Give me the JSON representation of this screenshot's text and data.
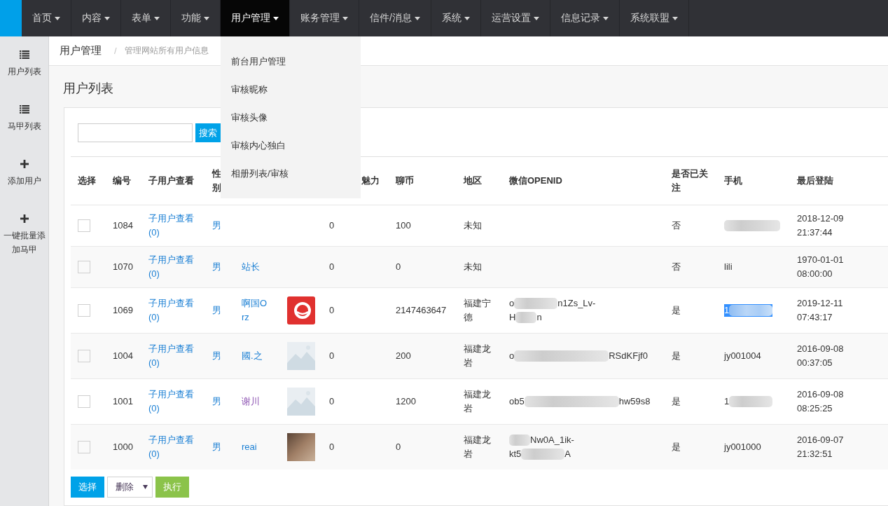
{
  "nav": {
    "items": [
      {
        "label": "首页",
        "selected": false
      },
      {
        "label": "内容",
        "selected": false
      },
      {
        "label": "表单",
        "selected": false
      },
      {
        "label": "功能",
        "selected": false
      },
      {
        "label": "用户管理",
        "selected": true,
        "menu": [
          "前台用户管理",
          "审核昵称",
          "审核头像",
          "审核内心独白",
          "相册列表/审核"
        ]
      },
      {
        "label": "账务管理",
        "selected": false
      },
      {
        "label": "信件/消息",
        "selected": false
      },
      {
        "label": "系统",
        "selected": false
      },
      {
        "label": "运营设置",
        "selected": false
      },
      {
        "label": "信息记录",
        "selected": false
      },
      {
        "label": "系统联盟",
        "selected": false
      }
    ]
  },
  "sidebar": {
    "items": [
      {
        "label": "用户列表",
        "kind": "list"
      },
      {
        "label": "马甲列表",
        "kind": "list"
      },
      {
        "label": "添加用户",
        "kind": "add"
      },
      {
        "label": "一键批量添加马甲",
        "kind": "add"
      }
    ]
  },
  "breadcrumb": {
    "title": "用户管理",
    "separator": "/",
    "description": "管理网站所有用户信息"
  },
  "page_title": "用户列表",
  "search": {
    "button": "搜索"
  },
  "table": {
    "columns": [
      {
        "label": "选择"
      },
      {
        "label": "编号"
      },
      {
        "label": "子用户查看"
      },
      {
        "label": "性别"
      },
      {},
      {},
      {},
      {
        "label": "魅力"
      },
      {
        "label": "聊币"
      },
      {
        "label": "地区"
      },
      {
        "label": "微信OPENID"
      },
      {
        "label": "是否已关注"
      },
      {
        "label": "手机"
      },
      {
        "label": "最后登陆"
      }
    ],
    "rows": [
      {
        "checked": false,
        "id": "1084",
        "sub_users": "子用户查看 (0)",
        "gender": "男",
        "column_7": "0",
        "coins": "100",
        "region": "未知",
        "followed": "否",
        "phone": {
          "highlighted": false,
          "parts": [
            {
              "kind": "wideblur"
            }
          ]
        },
        "last_login": "2018-12-09 21:37:44"
      },
      {
        "checked": false,
        "id": "1070",
        "sub_users": "子用户查看 (0)",
        "gender": "男",
        "nickname": {
          "text": "站长",
          "visited": false
        },
        "column_7": "0",
        "coins": "0",
        "region": "未知",
        "followed": "否",
        "phone": {
          "highlighted": false,
          "parts": [
            {
              "kind": "text",
              "text": "lili"
            }
          ]
        },
        "last_login": "1970-01-01 08:00:00"
      },
      {
        "checked": false,
        "id": "1069",
        "sub_users": "子用户查看 (0)",
        "gender": "男",
        "nickname": {
          "text": "啊国Orz",
          "visited": false
        },
        "avatar": {
          "kind": "logo"
        },
        "column_7": "0",
        "coins": "2147463647",
        "region": "福建宁德",
        "openid": {
          "lines": [
            [
              {
                "kind": "text",
                "text": "o"
              },
              {
                "kind": "blur"
              },
              {
                "kind": "text",
                "text": "n1Zs_Lv-"
              }
            ],
            [
              {
                "kind": "text",
                "text": "H"
              },
              {
                "kind": "shortblur"
              },
              {
                "kind": "text",
                "text": "n"
              }
            ]
          ]
        },
        "followed": "是",
        "phone": {
          "highlighted": true,
          "parts": [
            {
              "kind": "text",
              "text": "1"
            },
            {
              "kind": "blur"
            }
          ]
        },
        "last_login": "2019-12-11 07:43:17"
      },
      {
        "checked": false,
        "id": "1004",
        "sub_users": "子用户查看 (0)",
        "gender": "男",
        "nickname": {
          "text": "國.之",
          "visited": false
        },
        "avatar": {
          "kind": "placeholder"
        },
        "column_7": "0",
        "coins": "200",
        "region": "福建龙岩",
        "openid": {
          "lines": [
            [
              {
                "kind": "text",
                "text": "o"
              },
              {
                "kind": "longblur"
              },
              {
                "kind": "text",
                "text": "RSdKFjf0"
              }
            ]
          ]
        },
        "followed": "是",
        "phone": {
          "highlighted": false,
          "parts": [
            {
              "kind": "text",
              "text": "jy001004"
            }
          ]
        },
        "last_login": "2016-09-08 00:37:05"
      },
      {
        "checked": false,
        "id": "1001",
        "sub_users": "子用户查看 (0)",
        "gender": "男",
        "nickname": {
          "text": "谢川",
          "visited": true
        },
        "avatar": {
          "kind": "placeholder"
        },
        "column_7": "0",
        "coins": "1200",
        "region": "福建龙岩",
        "openid": {
          "lines": [
            [
              {
                "kind": "text",
                "text": "ob5"
              },
              {
                "kind": "longblur"
              },
              {
                "kind": "text",
                "text": "hw59s8"
              }
            ]
          ]
        },
        "followed": "是",
        "phone": {
          "highlighted": false,
          "parts": [
            {
              "kind": "text",
              "text": "1"
            },
            {
              "kind": "blur"
            }
          ]
        },
        "last_login": "2016-09-08 08:25:25"
      },
      {
        "checked": false,
        "id": "1000",
        "sub_users": "子用户查看 (0)",
        "gender": "男",
        "nickname": {
          "text": "reai",
          "visited": false
        },
        "avatar": {
          "kind": "photo"
        },
        "column_7": "0",
        "coins": "0",
        "region": "福建龙岩",
        "openid": {
          "lines": [
            [
              {
                "kind": "shortblur"
              },
              {
                "kind": "text",
                "text": "Nw0A_1ik-"
              }
            ],
            [
              {
                "kind": "text",
                "text": "kt5"
              },
              {
                "kind": "blur"
              },
              {
                "kind": "text",
                "text": "A"
              }
            ]
          ]
        },
        "followed": "是",
        "phone": {
          "highlighted": false,
          "parts": [
            {
              "kind": "text",
              "text": "jy001000"
            }
          ]
        },
        "last_login": "2016-09-07 21:32:51"
      }
    ]
  },
  "actions": {
    "select_button": "选择",
    "bulk_action": "删除",
    "execute_button": "执行"
  }
}
